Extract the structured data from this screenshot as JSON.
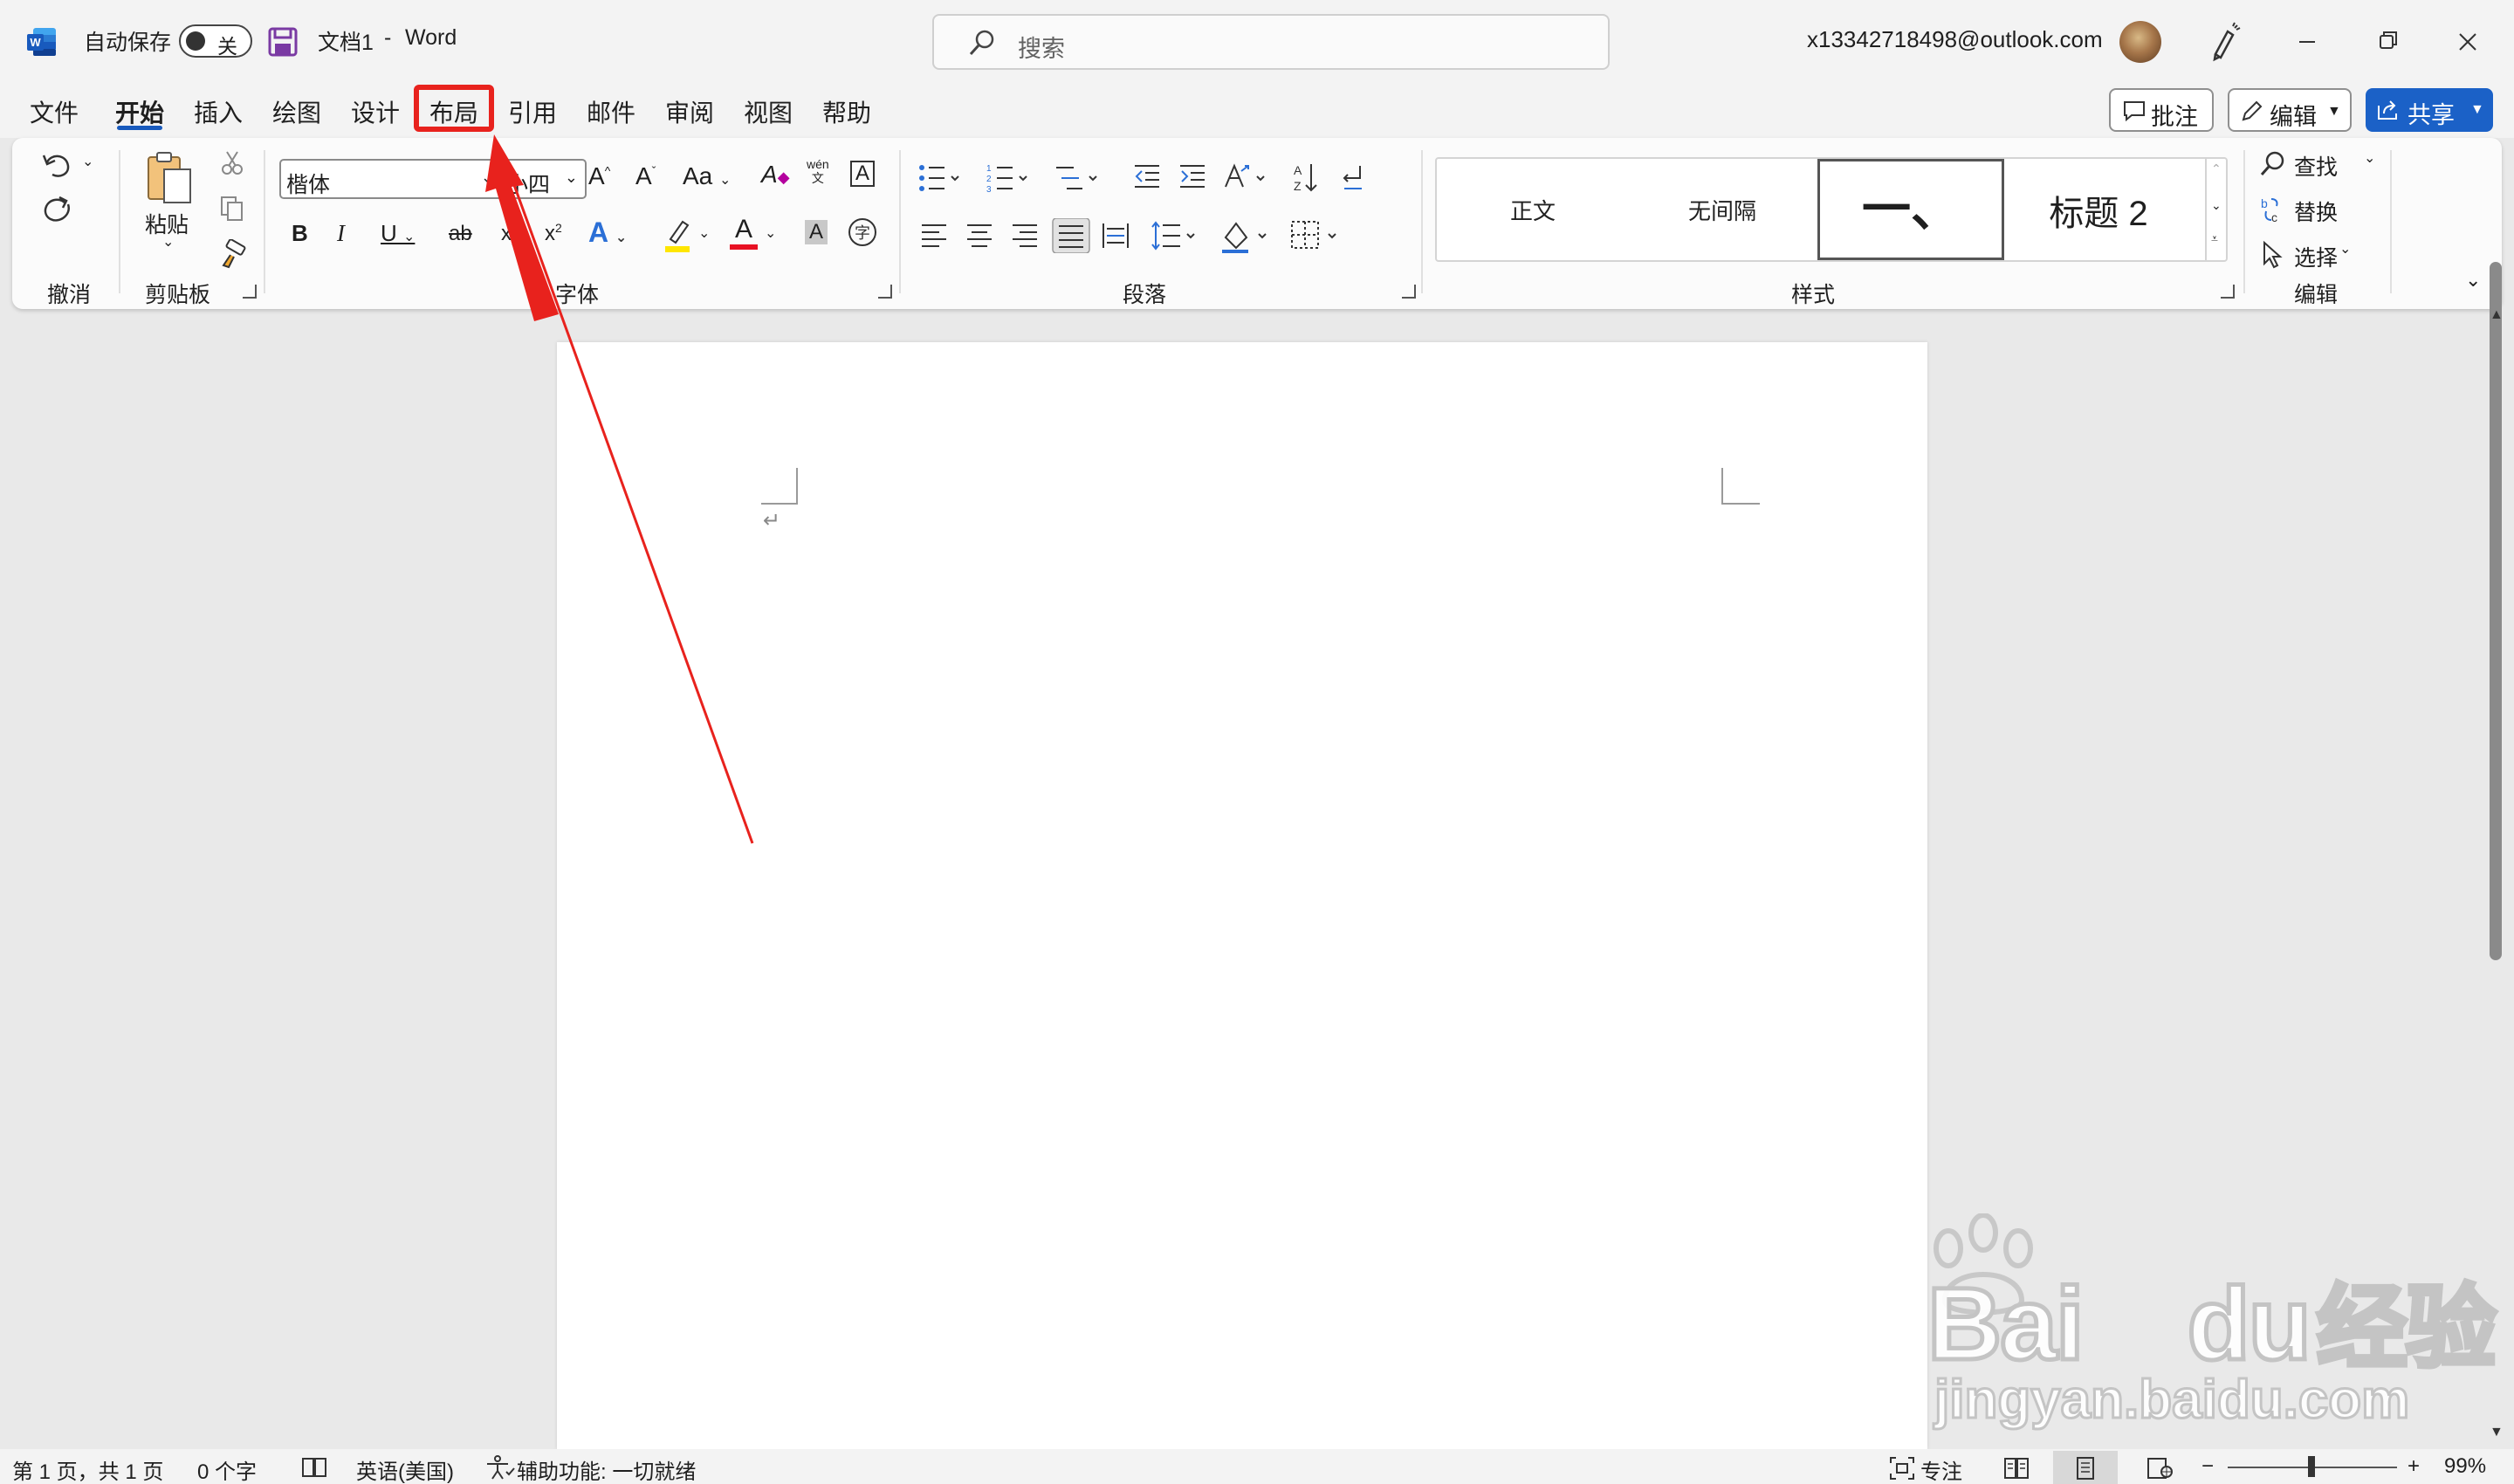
{
  "titlebar": {
    "app_icon": "word-logo-icon",
    "autosave_label": "自动保存",
    "autosave_state": "关",
    "doc_title": "文档1",
    "separator": "-",
    "app_name": "Word",
    "search_placeholder": "搜索",
    "account": "x13342718498@outlook.com"
  },
  "menu": {
    "tabs": [
      "文件",
      "开始",
      "插入",
      "绘图",
      "设计",
      "布局",
      "引用",
      "邮件",
      "审阅",
      "视图",
      "帮助"
    ],
    "active_tab": "开始",
    "highlighted_tab": "布局",
    "comments_label": "批注",
    "editing_label": "编辑",
    "share_label": "共享"
  },
  "ribbon": {
    "undo_group": "撤消",
    "clipboard": {
      "paste": "粘贴",
      "group": "剪贴板"
    },
    "font": {
      "name": "楷体",
      "size": "小四",
      "group": "字体",
      "grow": "A^",
      "shrink": "A˅",
      "change_case": "Aa",
      "phonetic": "wén",
      "bold": "B",
      "italic": "I",
      "underline": "U",
      "strike": "ab",
      "subscript": "x₂",
      "superscript": "x²",
      "effects": "A",
      "font_color": "A",
      "char_shading": "A",
      "enclose": "字"
    },
    "paragraph": {
      "group": "段落"
    },
    "styles": {
      "group": "样式",
      "items": [
        "正文",
        "无间隔",
        "一、",
        "标题 2"
      ]
    },
    "editing": {
      "find": "查找",
      "replace": "替换",
      "select": "选择",
      "group": "编辑"
    }
  },
  "document": {
    "paragraph_mark": "↵"
  },
  "statusbar": {
    "page": "第 1 页，共 1 页",
    "words": "0 个字",
    "language": "英语(美国)",
    "accessibility": "辅助功能: 一切就绪",
    "focus": "专注",
    "zoom": "99%"
  },
  "watermark": {
    "brand": "Bai",
    "brand2": "du",
    "cn": "经验",
    "url": "jingyan.baidu.com"
  },
  "colors": {
    "accent": "#185abd",
    "share": "#1b61c7",
    "highlight": "#e8221d",
    "word_blue": "#185abd"
  }
}
